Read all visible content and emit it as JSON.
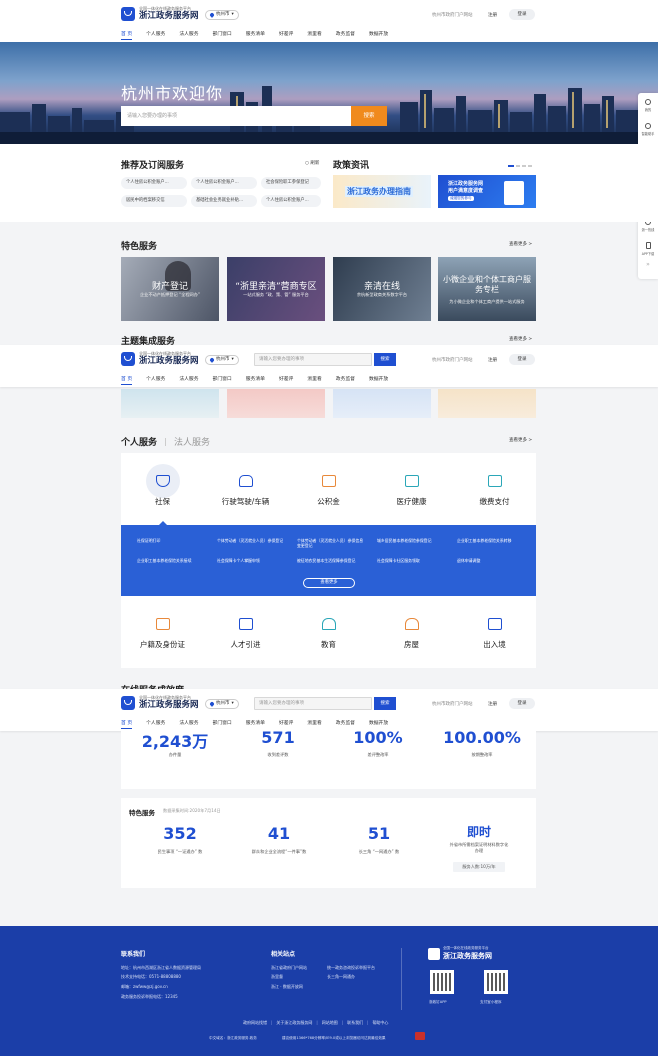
{
  "header": {
    "logo_sub": "全国一体化在线政务服务平台",
    "logo_main": "浙江政务服务网",
    "city": "杭州市",
    "portal": "杭州市政府门户网站",
    "register": "注册",
    "login": "登录",
    "search_placeholder": "请输入您要办理的事项",
    "search_button": "搜索"
  },
  "nav": [
    "首 页",
    "个人服务",
    "法人服务",
    "部门窗口",
    "服务清单",
    "好差评",
    "浙里看",
    "政务监督",
    "数据开放"
  ],
  "hero": {
    "title": "杭州市欢迎你",
    "search_placeholder": "请输入您要办理的事项",
    "search_button": "搜索"
  },
  "right_bar": [
    {
      "label": "我的",
      "icon": "user-icon"
    },
    {
      "label": "智能助手",
      "icon": "headset-icon"
    },
    {
      "label": "咨询投诉",
      "icon": "shield-icon"
    },
    {
      "label": "办件查询",
      "icon": "clock-icon"
    },
    {
      "label": "浙一支付",
      "icon": "pay-icon"
    },
    {
      "label": "浙一热线",
      "icon": "phone-icon"
    },
    {
      "label": "APP下载",
      "icon": "mobile-icon"
    }
  ],
  "recommend": {
    "title": "推荐及订阅服务",
    "refresh": "刷新",
    "chips": [
      "个人住房公积金账户...",
      "个人住房公积金账户...",
      "社会保险职工参保登记",
      "居民中的档案移交信",
      "基础社会业务就业补贴...",
      "个人住房公积金账户..."
    ]
  },
  "news": {
    "title": "政策资讯",
    "banner1": "浙江政务办理指南",
    "banner2_title": "浙江政务服务网",
    "banner2_sub": "用户满意度调查",
    "banner2_tag": "诚邀您的参与"
  },
  "featured": {
    "title": "特色服务",
    "more": "查看更多 >",
    "cards": [
      {
        "title": "财产登记",
        "sub": "企业不动产抵押登记 “全程网办”"
      },
      {
        "title": "“浙里亲清”营商专区",
        "sub": "一站式服务 “政、策、管” 服务平台"
      },
      {
        "title": "亲清在线",
        "sub": "余杭新型政商关系数字平台"
      },
      {
        "title": "小微企业和个体工商户服务专栏",
        "sub": "为小微企业和个体工商户提供一站式服务"
      }
    ]
  },
  "theme": {
    "title": "主题集成服务",
    "more": "查看更多 >"
  },
  "personal": {
    "tab_active": "个人服务",
    "tab_other": "法人服务",
    "more": "查看更多 >",
    "top_items": [
      {
        "label": "社保",
        "icon": "shield-icon"
      },
      {
        "label": "行驶驾驶/车辆",
        "icon": "car-icon"
      },
      {
        "label": "公积金",
        "icon": "house-fund-icon"
      },
      {
        "label": "医疗健康",
        "icon": "medical-icon"
      },
      {
        "label": "缴费支付",
        "icon": "wallet-icon"
      }
    ],
    "panel_items": [
      "社保证明打印",
      "个体劳动者（灵活就业人员）参保登记",
      "个体劳动者（灵活就业人员）参保信息变更登记",
      "城乡居民基本养老保险参保登记",
      "企业职工基本养老保险关系转移",
      "企业职工基本养老保险关系接续",
      "社会保障卡个人掌握申领",
      "被征地农民基本生活保障参保登记",
      "社会保障卡社区服务领取",
      "退休申请调整"
    ],
    "panel_more": "查看更多",
    "bottom_items": [
      {
        "label": "户籍及身份证",
        "icon": "id-card-icon"
      },
      {
        "label": "人才引进",
        "icon": "talent-icon"
      },
      {
        "label": "教育",
        "icon": "school-icon"
      },
      {
        "label": "房屋",
        "icon": "house-icon"
      },
      {
        "label": "出入境",
        "icon": "luggage-icon"
      }
    ]
  },
  "online": {
    "title": "在线服务成效度"
  },
  "stats": [
    {
      "value": "2,243万",
      "label": "办件量"
    },
    {
      "value": "571",
      "label": "收到差评数"
    },
    {
      "value": "100%",
      "label": "差评整改率"
    },
    {
      "value": "100.00%",
      "label": "按期整改率"
    }
  ],
  "special": {
    "title": "特色服务",
    "stamp": "数据采集时间:2020年7月14日",
    "items": [
      {
        "value": "352",
        "label": "民生事项 “一证通办” 数"
      },
      {
        "value": "41",
        "label": "群众和企业全流程“一件事”数"
      },
      {
        "value": "51",
        "label": "长三角 “一网通办” 数"
      },
      {
        "value": "即时",
        "label": "外省市所需档案证明材料数字化办理"
      }
    ],
    "subscribe": "服务人数:10万/年"
  },
  "footer": {
    "contact_title": "联系我们",
    "contact_lines": [
      "地址：杭州市西湖区浙江省人数据资源管理局",
      "技术支持电话：0571-88808880",
      "邮箱：zwfww@zj.gov.cn",
      "政务服务投诉举报电话：12345"
    ],
    "links_title": "相关站点",
    "links": [
      [
        "浙江省政府门户网站",
        "统一政务咨询投诉举报平台"
      ],
      [
        "浙里督",
        "长三角一网通办"
      ],
      [
        "浙江 · 数据开放网",
        ""
      ]
    ],
    "brand_sub": "全国一体化在线政务服务平台",
    "brand_main": "浙江政务服务网",
    "qr1": "浙政钉APP",
    "qr2": "支付宝小程序",
    "bottom_links": [
      "政府网站找错",
      "关于浙江政务服务网",
      "网站地图",
      "联系我们",
      "帮助中心"
    ],
    "copyright": "中文域名：浙江政务服务.政务",
    "icp": "建议使用1366*768分辨率/IE9.0或以上浏览器访问达到最佳效果"
  }
}
